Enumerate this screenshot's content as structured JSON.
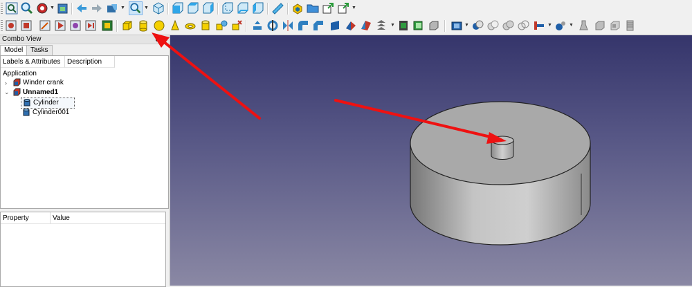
{
  "panel": {
    "title": "Combo View",
    "float_glyph": "⧉",
    "close_glyph": "×",
    "tabs": [
      {
        "label": "Model"
      },
      {
        "label": "Tasks"
      }
    ],
    "tree_columns": [
      "Labels & Attributes",
      "Description"
    ],
    "tree_root": "Application",
    "documents": [
      {
        "label": "Winder crank",
        "expanded": false
      },
      {
        "label": "Unnamed1",
        "expanded": true,
        "children": [
          "Cylinder",
          "Cylinder001"
        ]
      }
    ],
    "expanders": {
      "collapsed": "›",
      "expanded": "⌄"
    },
    "property_columns": [
      "Property",
      "Value"
    ]
  },
  "toolbar1": {
    "icons": [
      "std-viewfit-icon",
      "zoom-icon",
      "draw-style-icon",
      "std-view-icon",
      "nav-back-icon",
      "nav-forward-icon",
      "workbench-icon",
      "zoom-box-icon",
      "view-isometric-icon",
      "view-front-icon",
      "view-top-icon",
      "view-right-icon",
      "view-rear-icon",
      "view-bottom-icon",
      "view-left-icon",
      "measure-icon",
      "part-icon",
      "folder-icon",
      "link-make-icon",
      "link-select-icon"
    ]
  },
  "toolbar2": {
    "icons": [
      "macro-record-icon",
      "macro-stop-icon",
      "macro-edit-icon",
      "macro-execute-icon",
      "macro-debug-icon",
      "macro-step-icon",
      "box-icon",
      "cylinder-icon",
      "sphere-icon",
      "cone-icon",
      "torus-icon",
      "tube-icon",
      "primitives-icon",
      "shape-builder-icon",
      "extrude-icon",
      "revolve-icon",
      "mirror-icon",
      "fillet-icon",
      "chamfer-icon",
      "make-face-icon",
      "ruled-surface-icon",
      "loft-icon",
      "sweep-icon",
      "section-icon",
      "cross-sections-icon",
      "offset-icon",
      "thickness-icon",
      "boolean-icon",
      "cut-icon",
      "fuse-icon",
      "common-icon",
      "join-icon",
      "split-icon",
      "check-geometry-icon",
      "defeaturing-icon",
      "attachment-icon",
      "color-per-face-icon"
    ]
  },
  "colors": {
    "arrow": "#ee1111",
    "viewport_top": "#35356b",
    "viewport_bottom": "#8a88a4",
    "solid": "#a8a8a8"
  }
}
